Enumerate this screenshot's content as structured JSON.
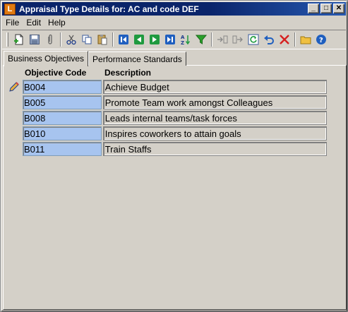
{
  "window": {
    "icon_letter": "L",
    "title": "Appraisal Type Details for: AC and code DEF",
    "btn_minimize": "_",
    "btn_maximize": "□",
    "btn_close": "✕"
  },
  "menu": [
    "File",
    "Edit",
    "Help"
  ],
  "toolbar": {
    "icons": [
      "new-record-icon",
      "save-icon",
      "attach-icon",
      "cut-icon",
      "copy-icon",
      "paste-icon",
      "first-record-icon",
      "previous-record-icon",
      "next-record-icon",
      "last-record-icon",
      "sort-az-icon",
      "filter-icon",
      "insert-row-icon",
      "append-row-icon",
      "refresh-icon",
      "undo-icon",
      "delete-icon",
      "open-folder-icon",
      "help-icon"
    ]
  },
  "tabs": [
    {
      "label": "Business Objectives",
      "active": true
    },
    {
      "label": "Performance Standards",
      "active": false
    }
  ],
  "grid": {
    "columns": [
      "Objective Code",
      "Description"
    ],
    "rows": [
      {
        "code": "B004",
        "description": "Achieve Budget",
        "editing": true
      },
      {
        "code": "B005",
        "description": "Promote Team work amongst Colleagues",
        "editing": false
      },
      {
        "code": "B008",
        "description": "Leads internal teams/task forces",
        "editing": false
      },
      {
        "code": "B010",
        "description": "Inspires coworkers to attain goals",
        "editing": false
      },
      {
        "code": "B011",
        "description": "Train Staffs",
        "editing": false
      }
    ]
  },
  "colors": {
    "title_bar": "#0a246a",
    "code_cell_bg": "#a7c4ef",
    "window_bg": "#d4d0c8"
  }
}
